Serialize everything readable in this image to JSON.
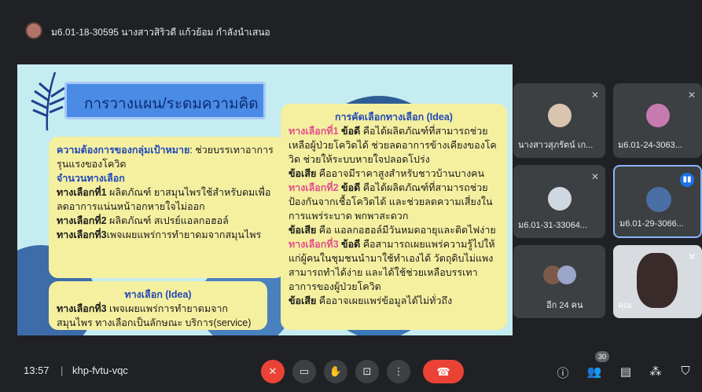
{
  "presenter": {
    "name": "ม6.01-18-30595 นางสาวสิริวดี แก้วย้อม กำลังนำเสนอ"
  },
  "slide": {
    "title": "การวางแผน/ระดมความคิด",
    "left_panel": {
      "need_label": "ความต้องการของกลุ่มเป้าหมาย",
      "need_text": ": ช่วยบรรเทาอาการรุนแรงของโควิด",
      "options_label": "จำนวนทางเลือก",
      "opt1_label": "ทางเลือกที่1",
      "opt1_text": " ผลิตภัณฑ์ ยาสมุนไพรใช้สำหรับดมเพื่อลดอาการแน่นหน้าอกหายใจไม่ออก",
      "opt2_label": "ทางเลือกที่2",
      "opt2_text": " ผลิตภัณฑ์ สเปรย์แอลกอฮอล์",
      "opt3_label": "ทางเลือกที่3",
      "opt3_text": "เพจเผยแพร่การทำยาดมจากสมุนไพร"
    },
    "idea_panel": {
      "title": "ทางเลือก (Idea)",
      "opt_label": "ทางเลือกที่3",
      "opt_text": " เพจเผยแพร่การทำยาดมจากสมุนไพร ทางเลือกเป็นลักษณะ บริการ(service)"
    },
    "right_panel": {
      "title": "การคัดเลือกทางเลือก (Idea)",
      "o1": "ทางเลือกที่1",
      "adv": "ข้อดี",
      "o1_adv": " คือได้ผลิตภัณฑ์ที่สามารถช่วยเหลือผู้ป่วยโควิดได้ ช่วยลดอาการข้างเคียงของโควิด ช่วยให้ระบบหายใจปลอดโปร่ง",
      "dis": "ข้อเสีย",
      "o1_dis": " คืออาจมีราคาสูงสำหรับชาวบ้านบางคน",
      "o2": "ทางเลือกที่2",
      "o2_adv": " คือได้ผลิตภัณฑ์ที่สามารถช่วยป้องกันจากเชื้อโควิดได้ และช่วยลดความเสี่ยงในการแพร่ระบาด พกพาสะดวก",
      "o2_dis": " คือ แอลกอฮอล์มีวันหมดอายุและติดไฟง่าย",
      "o3": "ทางเลือกที่3",
      "o3_adv": " คือสามารถเผยแพร่ความรู้ไปให้แก่ผู้คนในชุมชนนำมาใช้ทำเองได้ วัตถุดิบไม่แพงสามารถทำได้ง่าย และได้ใช้ช่วยเหลือบรรเทาอาการของผู้ป่วยโควิด",
      "o3_dis": " คืออาจเผยแพร่ข้อมูลได้ไม่ทั่วถึง"
    }
  },
  "participants": [
    {
      "name": "นางสาวสุภรัตน์ เก..."
    },
    {
      "name": "ม6.01-24-3063..."
    },
    {
      "name": "ม6.01-31-33064..."
    },
    {
      "name": "ม6.01-29-3066..."
    },
    {
      "name": "อีก 24 คน"
    },
    {
      "name": "คุณ"
    }
  ],
  "bottom": {
    "time": "13:57",
    "separator": "|",
    "meeting_code": "khp-fvtu-vqc",
    "people_count": "30"
  },
  "colors": {
    "background": "#202124",
    "end_call": "#ea4335",
    "speaking_ring": "#8ab4f8"
  }
}
